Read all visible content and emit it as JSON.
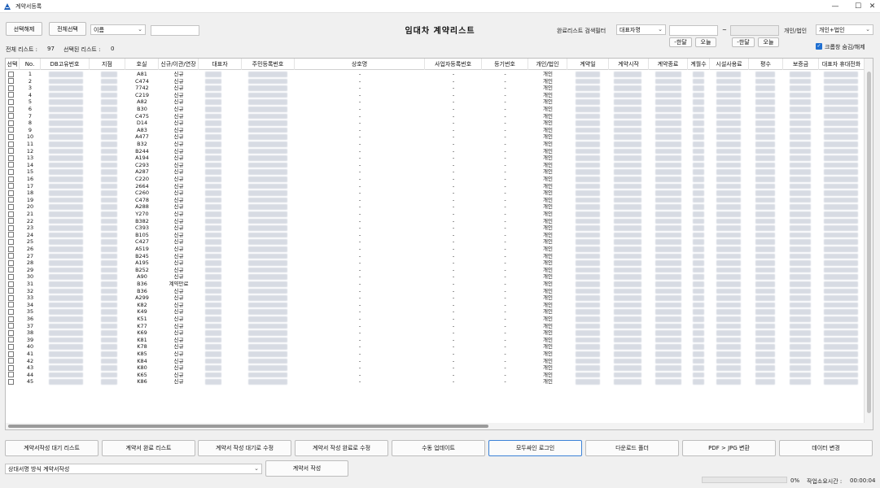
{
  "window": {
    "title": "계약서등록",
    "minimize": "—",
    "maximize": "☐",
    "close": "✕"
  },
  "toolbar": {
    "deselect_all": "선택해제",
    "select_all": "전체선택",
    "search_field_select": "이름",
    "search_value": "",
    "filter_label": "완료리스트 검색필터",
    "filter_select": "대표자명",
    "filter_value": "",
    "date_from": "",
    "date_tilde": "~",
    "date_to": "",
    "last_month_1": "-한달",
    "today_1": "오늘",
    "last_month_2": "-한달",
    "today_2": "오늘",
    "person_corp_label": "개인/법인",
    "person_corp_select": "개인+법인",
    "trim_label": "크롭창 숨김/해제",
    "trim_checked": true
  },
  "page_title": "임대차 계약리스트",
  "counts": {
    "total_label": "전체 리스트 :",
    "total_value": "97",
    "selected_label": "선택된 리스트 :",
    "selected_value": "0"
  },
  "table": {
    "columns": [
      "선택",
      "No.",
      "DB고유번호",
      "지점",
      "호실",
      "신규/이관/연장",
      "대표자",
      "주민등록번호",
      "상호명",
      "사업자등록번호",
      "등기번호",
      "개인/법인",
      "계약일",
      "계약시작",
      "계약종료",
      "계월수",
      "시설사용료",
      "평수",
      "보증금",
      "대표자 휴대전화"
    ],
    "rows": [
      {
        "no": "1",
        "room": "A81",
        "type": "신규",
        "company": "-",
        "bizno": "-",
        "regno": "-",
        "kind": "개인"
      },
      {
        "no": "2",
        "room": "C474",
        "type": "신규",
        "company": "-",
        "bizno": "-",
        "regno": "-",
        "kind": "개인"
      },
      {
        "no": "3",
        "room": "7742",
        "type": "신규",
        "company": "-",
        "bizno": "-",
        "regno": "-",
        "kind": "개인"
      },
      {
        "no": "4",
        "room": "C219",
        "type": "신규",
        "company": "-",
        "bizno": "-",
        "regno": "-",
        "kind": "개인"
      },
      {
        "no": "5",
        "room": "A82",
        "type": "신규",
        "company": "-",
        "bizno": "-",
        "regno": "-",
        "kind": "개인"
      },
      {
        "no": "6",
        "room": "B30",
        "type": "신규",
        "company": "-",
        "bizno": "-",
        "regno": "-",
        "kind": "개인"
      },
      {
        "no": "7",
        "room": "C475",
        "type": "신규",
        "company": "-",
        "bizno": "-",
        "regno": "-",
        "kind": "개인"
      },
      {
        "no": "8",
        "room": "D14",
        "type": "신규",
        "company": "-",
        "bizno": "-",
        "regno": "-",
        "kind": "개인"
      },
      {
        "no": "9",
        "room": "A83",
        "type": "신규",
        "company": "-",
        "bizno": "-",
        "regno": "-",
        "kind": "개인"
      },
      {
        "no": "10",
        "room": "A477",
        "type": "신규",
        "company": "-",
        "bizno": "-",
        "regno": "-",
        "kind": "개인"
      },
      {
        "no": "11",
        "room": "B32",
        "type": "신규",
        "company": "-",
        "bizno": "-",
        "regno": "-",
        "kind": "개인"
      },
      {
        "no": "12",
        "room": "B244",
        "type": "신규",
        "company": "-",
        "bizno": "-",
        "regno": "-",
        "kind": "개인"
      },
      {
        "no": "13",
        "room": "A194",
        "type": "신규",
        "company": "-",
        "bizno": "-",
        "regno": "-",
        "kind": "개인"
      },
      {
        "no": "14",
        "room": "C293",
        "type": "신규",
        "company": "-",
        "bizno": "-",
        "regno": "-",
        "kind": "개인"
      },
      {
        "no": "15",
        "room": "A287",
        "type": "신규",
        "company": "-",
        "bizno": "-",
        "regno": "-",
        "kind": "개인"
      },
      {
        "no": "16",
        "room": "C220",
        "type": "신규",
        "company": "-",
        "bizno": "-",
        "regno": "-",
        "kind": "개인"
      },
      {
        "no": "17",
        "room": "2664",
        "type": "신규",
        "company": "-",
        "bizno": "-",
        "regno": "-",
        "kind": "개인"
      },
      {
        "no": "18",
        "room": "C260",
        "type": "신규",
        "company": "-",
        "bizno": "-",
        "regno": "-",
        "kind": "개인"
      },
      {
        "no": "19",
        "room": "C478",
        "type": "신규",
        "company": "-",
        "bizno": "-",
        "regno": "-",
        "kind": "개인"
      },
      {
        "no": "20",
        "room": "A288",
        "type": "신규",
        "company": "-",
        "bizno": "-",
        "regno": "-",
        "kind": "개인"
      },
      {
        "no": "21",
        "room": "Y270",
        "type": "신규",
        "company": "-",
        "bizno": "-",
        "regno": "-",
        "kind": "개인"
      },
      {
        "no": "22",
        "room": "B382",
        "type": "신규",
        "company": "-",
        "bizno": "-",
        "regno": "-",
        "kind": "개인"
      },
      {
        "no": "23",
        "room": "C393",
        "type": "신규",
        "company": "-",
        "bizno": "-",
        "regno": "-",
        "kind": "개인"
      },
      {
        "no": "24",
        "room": "B105",
        "type": "신규",
        "company": "-",
        "bizno": "-",
        "regno": "-",
        "kind": "개인"
      },
      {
        "no": "25",
        "room": "C427",
        "type": "신규",
        "company": "-",
        "bizno": "-",
        "regno": "-",
        "kind": "개인"
      },
      {
        "no": "26",
        "room": "A519",
        "type": "신규",
        "company": "-",
        "bizno": "-",
        "regno": "-",
        "kind": "개인"
      },
      {
        "no": "27",
        "room": "B245",
        "type": "신규",
        "company": "-",
        "bizno": "-",
        "regno": "-",
        "kind": "개인"
      },
      {
        "no": "28",
        "room": "A195",
        "type": "신규",
        "company": "-",
        "bizno": "-",
        "regno": "-",
        "kind": "개인"
      },
      {
        "no": "29",
        "room": "B252",
        "type": "신규",
        "company": "-",
        "bizno": "-",
        "regno": "-",
        "kind": "개인"
      },
      {
        "no": "30",
        "room": "A90",
        "type": "신규",
        "company": "-",
        "bizno": "-",
        "regno": "-",
        "kind": "개인"
      },
      {
        "no": "31",
        "room": "B36",
        "type": "계약만료",
        "company": "-",
        "bizno": "-",
        "regno": "-",
        "kind": "개인"
      },
      {
        "no": "32",
        "room": "B36",
        "type": "신규",
        "company": "-",
        "bizno": "-",
        "regno": "-",
        "kind": "개인"
      },
      {
        "no": "33",
        "room": "A299",
        "type": "신규",
        "company": "-",
        "bizno": "-",
        "regno": "-",
        "kind": "개인"
      },
      {
        "no": "34",
        "room": "K82",
        "type": "신규",
        "company": "-",
        "bizno": "-",
        "regno": "-",
        "kind": "개인"
      },
      {
        "no": "35",
        "room": "K49",
        "type": "신규",
        "company": "-",
        "bizno": "-",
        "regno": "-",
        "kind": "개인"
      },
      {
        "no": "36",
        "room": "K51",
        "type": "신규",
        "company": "-",
        "bizno": "-",
        "regno": "-",
        "kind": "개인"
      },
      {
        "no": "37",
        "room": "K77",
        "type": "신규",
        "company": "-",
        "bizno": "-",
        "regno": "-",
        "kind": "개인"
      },
      {
        "no": "38",
        "room": "K69",
        "type": "신규",
        "company": "-",
        "bizno": "-",
        "regno": "-",
        "kind": "개인"
      },
      {
        "no": "39",
        "room": "K81",
        "type": "신규",
        "company": "-",
        "bizno": "-",
        "regno": "-",
        "kind": "개인"
      },
      {
        "no": "40",
        "room": "K78",
        "type": "신규",
        "company": "-",
        "bizno": "-",
        "regno": "-",
        "kind": "개인"
      },
      {
        "no": "41",
        "room": "K85",
        "type": "신규",
        "company": "-",
        "bizno": "-",
        "regno": "-",
        "kind": "개인"
      },
      {
        "no": "42",
        "room": "K84",
        "type": "신규",
        "company": "-",
        "bizno": "-",
        "regno": "-",
        "kind": "개인"
      },
      {
        "no": "43",
        "room": "K80",
        "type": "신규",
        "company": "-",
        "bizno": "-",
        "regno": "-",
        "kind": "개인"
      },
      {
        "no": "44",
        "room": "K65",
        "type": "신규",
        "company": "-",
        "bizno": "-",
        "regno": "-",
        "kind": "개인"
      },
      {
        "no": "45",
        "room": "K86",
        "type": "신규",
        "company": "-",
        "bizno": "-",
        "regno": "-",
        "kind": "개인"
      }
    ]
  },
  "bottom_buttons": [
    "계약서작성 대기 리스트",
    "계약서 완료 리스트",
    "계약서 작성 대기로 수정",
    "계약서 작성 완료로 수정",
    "수동 업데이트",
    "모두싸인 로그인",
    "다운로드 폴더",
    "PDF > JPG 변환",
    "데이터 변경"
  ],
  "footer": {
    "template_select": "상대서명 방식 계약서작성",
    "write_button": "계약서 작성",
    "progress_percent": "0%",
    "progress_fraction": 0,
    "elapsed_label": "작업소요시간 :",
    "elapsed_value": "00:00:04"
  },
  "colors": {
    "accent": "#3c82d7",
    "check": "#1f6fd1",
    "redacted": "#d7dbe3"
  }
}
